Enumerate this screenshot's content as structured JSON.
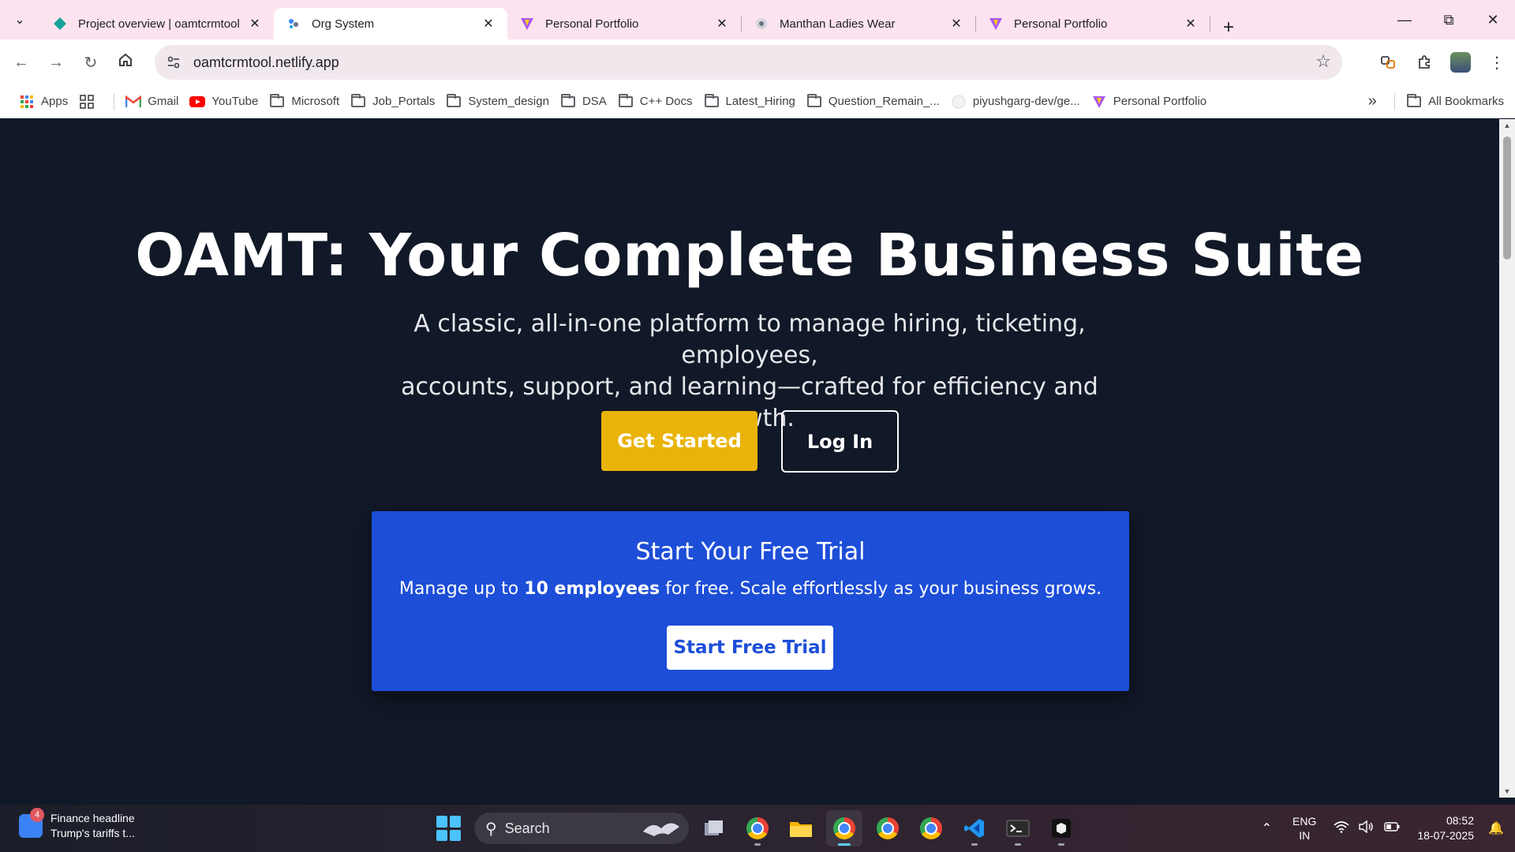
{
  "browser": {
    "tabs": [
      {
        "title": "Project overview | oamtcrmtool",
        "icon": "supabase-icon",
        "active": false
      },
      {
        "title": "Org System",
        "icon": "org-system-icon",
        "active": true
      },
      {
        "title": "Personal Portfolio",
        "icon": "vite-icon",
        "active": false
      },
      {
        "title": "Manthan Ladies Wear",
        "icon": "site-icon",
        "active": false
      },
      {
        "title": "Personal Portfolio",
        "icon": "vite-icon",
        "active": false
      }
    ],
    "url": "oamtcrmtool.netlify.app",
    "bookmarks": [
      {
        "label": "Apps",
        "icon": "apps-grid-icon"
      },
      {
        "label": "",
        "icon": "tab-groups-icon"
      },
      {
        "label": "Gmail",
        "icon": "gmail-icon"
      },
      {
        "label": "YouTube",
        "icon": "youtube-icon"
      },
      {
        "label": "Microsoft",
        "icon": "folder-icon"
      },
      {
        "label": "Job_Portals",
        "icon": "folder-icon"
      },
      {
        "label": "System_design",
        "icon": "folder-icon"
      },
      {
        "label": "DSA",
        "icon": "folder-icon"
      },
      {
        "label": "C++ Docs",
        "icon": "folder-icon"
      },
      {
        "label": "Latest_Hiring",
        "icon": "folder-icon"
      },
      {
        "label": "Question_Remain_...",
        "icon": "folder-icon"
      },
      {
        "label": "piyushgarg-dev/ge...",
        "icon": "github-icon"
      },
      {
        "label": "Personal Portfolio",
        "icon": "vite-icon"
      }
    ],
    "all_bookmarks": "All Bookmarks"
  },
  "page": {
    "title": "OAMT: Your Complete Business Suite",
    "subtitle_line1": "A classic, all-in-one platform to manage hiring, ticketing, employees,",
    "subtitle_line2": "accounts, support, and learning—crafted for efficiency and growth.",
    "primary_cta": "Get Started",
    "secondary_cta": "Log In",
    "trial": {
      "title": "Start Your Free Trial",
      "desc_before": "Manage up to ",
      "desc_bold": "10 employees",
      "desc_after": " for free. Scale effortlessly as your business grows.",
      "button": "Start Free Trial"
    }
  },
  "taskbar": {
    "news_badge": "4",
    "news_title": "Finance headline",
    "news_text": "Trump's tariffs t...",
    "search_label": "Search",
    "lang_line1": "ENG",
    "lang_line2": "IN",
    "time": "08:52",
    "date": "18-07-2025"
  },
  "colors": {
    "page_bg": "#111827",
    "accent_yellow": "#eab308",
    "trial_blue": "#1d4ed8",
    "tabstrip_bg": "#fde3f0"
  }
}
